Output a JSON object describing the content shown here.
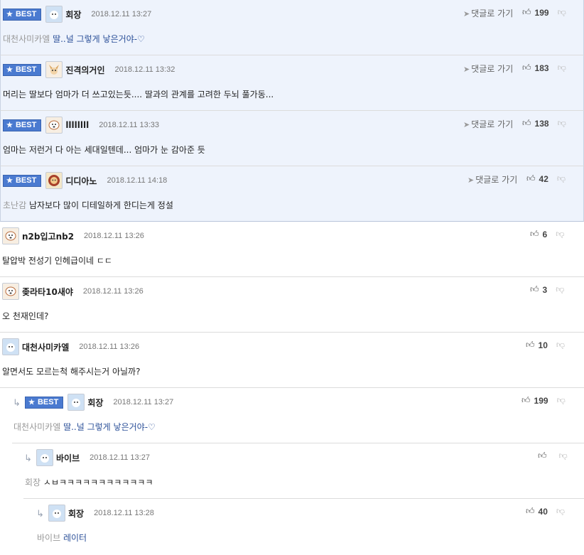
{
  "best_label": "BEST",
  "reply_link_label": "댓글로 가기",
  "comments": [
    {
      "nick": "회장",
      "date": "2018.12.11 13:27",
      "votes": "199",
      "mention": "대천사미카엘",
      "text": "딸..널 그렇게 낳은거야-♡"
    },
    {
      "nick": "진격의거인",
      "date": "2018.12.11 13:32",
      "votes": "183",
      "mention": "",
      "text": "머리는 딸보다 엄마가 더 쓰고있는듯.... 딸과의 관계를 고려한 두뇌 풀가동..."
    },
    {
      "nick": "llllllll",
      "date": "2018.12.11 13:33",
      "votes": "138",
      "mention": "",
      "text": "엄마는 저런거 다 아는 세대일텐데... 엄마가 눈 감아준 듯"
    },
    {
      "nick": "디디아노",
      "date": "2018.12.11 14:18",
      "votes": "42",
      "mention": "초난감",
      "text": "남자보다 많이 디테일하게 한디는게 정설"
    },
    {
      "nick": "n2b입고nb2",
      "date": "2018.12.11 13:26",
      "votes": "6",
      "mention": "",
      "text": "탈압박 전성기 인헤급이네 ㄷㄷ"
    },
    {
      "nick": "좆라타10새야",
      "date": "2018.12.11 13:26",
      "votes": "3",
      "mention": "",
      "text": "오 천재인데?"
    },
    {
      "nick": "대천사미카엘",
      "date": "2018.12.11 13:26",
      "votes": "10",
      "mention": "",
      "text": "알면서도 모르는척 해주시는거 아닐까?"
    },
    {
      "nick": "회장",
      "date": "2018.12.11 13:27",
      "votes": "199",
      "mention": "대천사미카엘",
      "text": "딸..널 그렇게 낳은거야-♡"
    },
    {
      "nick": "바이브",
      "date": "2018.12.11 13:27",
      "votes": "",
      "mention": "회장",
      "text": "ㅅㅂㅋㅋㅋㅋㅋㅋㅋㅋㅋㅋㅋㅋ"
    },
    {
      "nick": "회장",
      "date": "2018.12.11 13:28",
      "votes": "40",
      "mention": "바이브",
      "text": "레이터"
    }
  ]
}
